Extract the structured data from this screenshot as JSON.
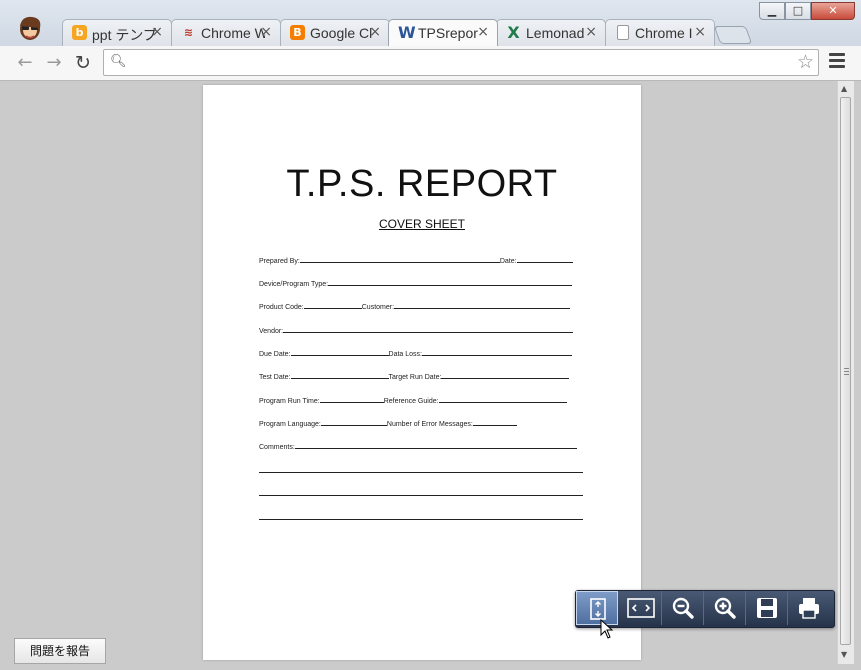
{
  "tabs": [
    {
      "label": "ppt テンプ",
      "icon": "blogger-b-icon",
      "color": "#f5a623"
    },
    {
      "label": "Chrome W",
      "icon": "chrome-books-icon",
      "color": "#c0392b"
    },
    {
      "label": "Google Cl",
      "icon": "blogger-icon",
      "color": "#f57d00"
    },
    {
      "label": "TPSrepor",
      "icon": "word-doc-icon",
      "color": "#2b579a",
      "active": true
    },
    {
      "label": "Lemonad",
      "icon": "excel-sheet-icon",
      "color": "#1f7a4c"
    },
    {
      "label": "Chrome I",
      "icon": "blank-page-icon",
      "color": "#888888"
    }
  ],
  "omnibox": {
    "value": "",
    "placeholder": ""
  },
  "document": {
    "title": "T.P.S. REPORT",
    "subtitle": "COVER SHEET",
    "fields": [
      {
        "a": "Prepared By:",
        "b": "Date:"
      },
      {
        "a": "Device/Program Type:",
        "b": ""
      },
      {
        "a": "Product Code:",
        "b": "Customer:"
      },
      {
        "a": "Vendor:",
        "b": ""
      },
      {
        "a": "Due Date:",
        "b": "Data Loss:"
      },
      {
        "a": "Test Date:",
        "b": "Target Run Date:"
      },
      {
        "a": "Program Run Time:",
        "b": "Reference Guide:"
      },
      {
        "a": "Program Language:",
        "b": "Number of Error Messages:"
      },
      {
        "a": "Comments:",
        "b": ""
      }
    ]
  },
  "pdf_toolbar": [
    "fit-page-icon",
    "fit-width-icon",
    "zoom-out-icon",
    "zoom-in-icon",
    "save-icon",
    "print-icon"
  ],
  "report_button": "問題を報告"
}
